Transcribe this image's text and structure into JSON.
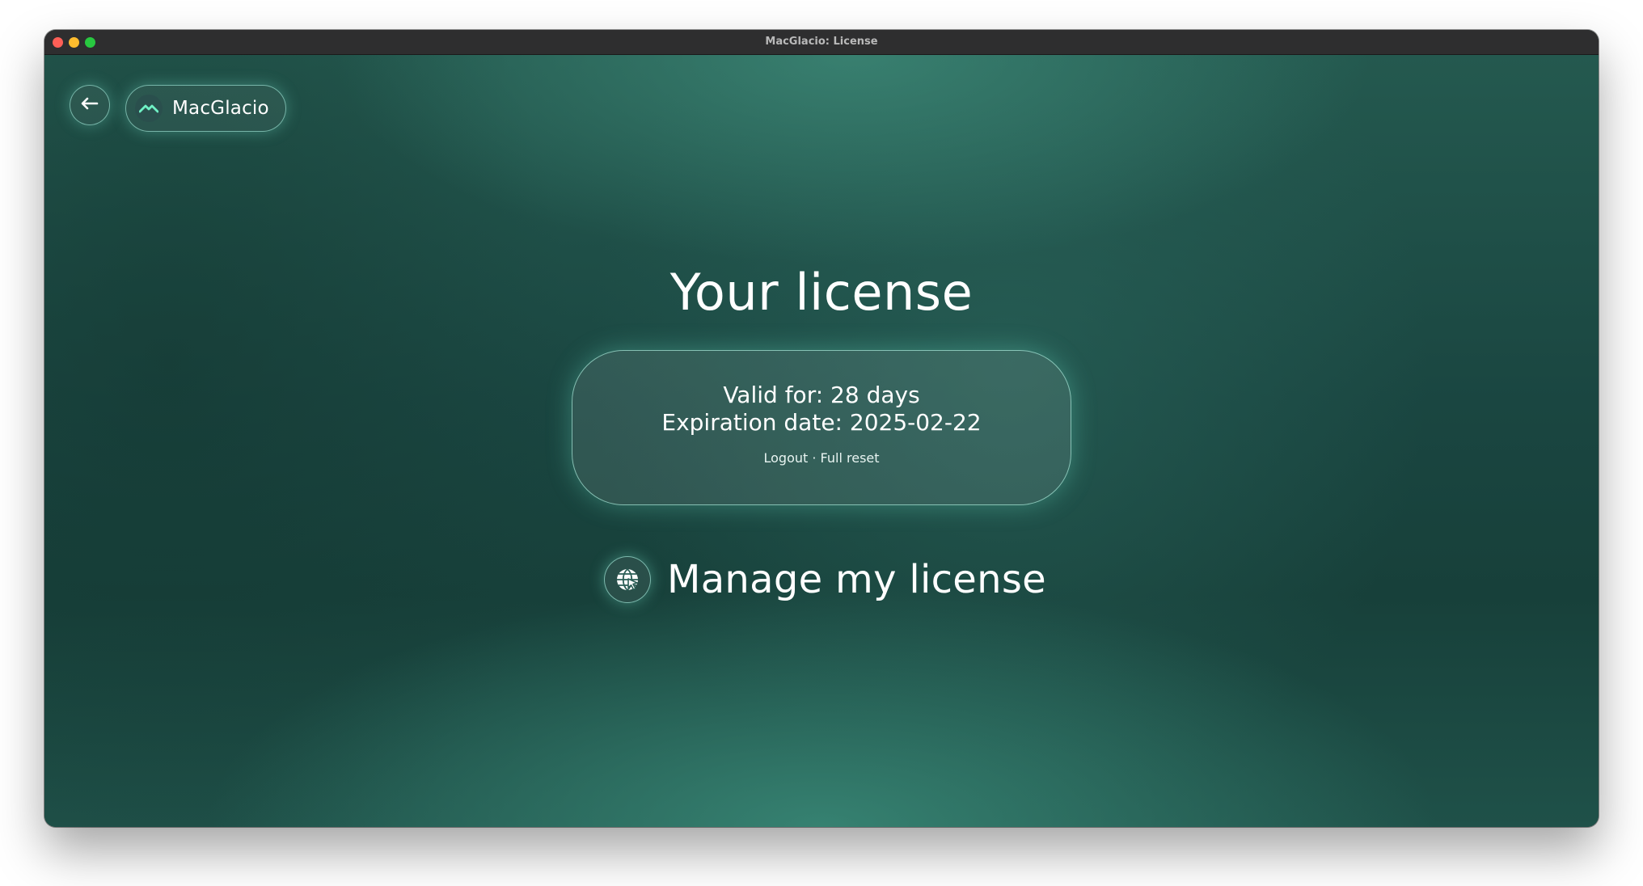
{
  "window": {
    "title": "MacGlacio: License"
  },
  "header": {
    "back_icon": "arrow-left-icon",
    "brand_icon": "mountain-logo-icon",
    "brand_name": "MacGlacio"
  },
  "main": {
    "title": "Your license",
    "license": {
      "valid_for": "Valid for: 28 days",
      "expiration": "Expiration date: 2025-02-22",
      "logout_label": "Logout",
      "separator": "·",
      "full_reset_label": "Full reset"
    },
    "manage": {
      "icon": "globe-cursor-icon",
      "label": "Manage my license"
    }
  },
  "colors": {
    "accent": "#5fe0b8",
    "background": "#163c37",
    "titlebar": "#2e2e2f"
  }
}
